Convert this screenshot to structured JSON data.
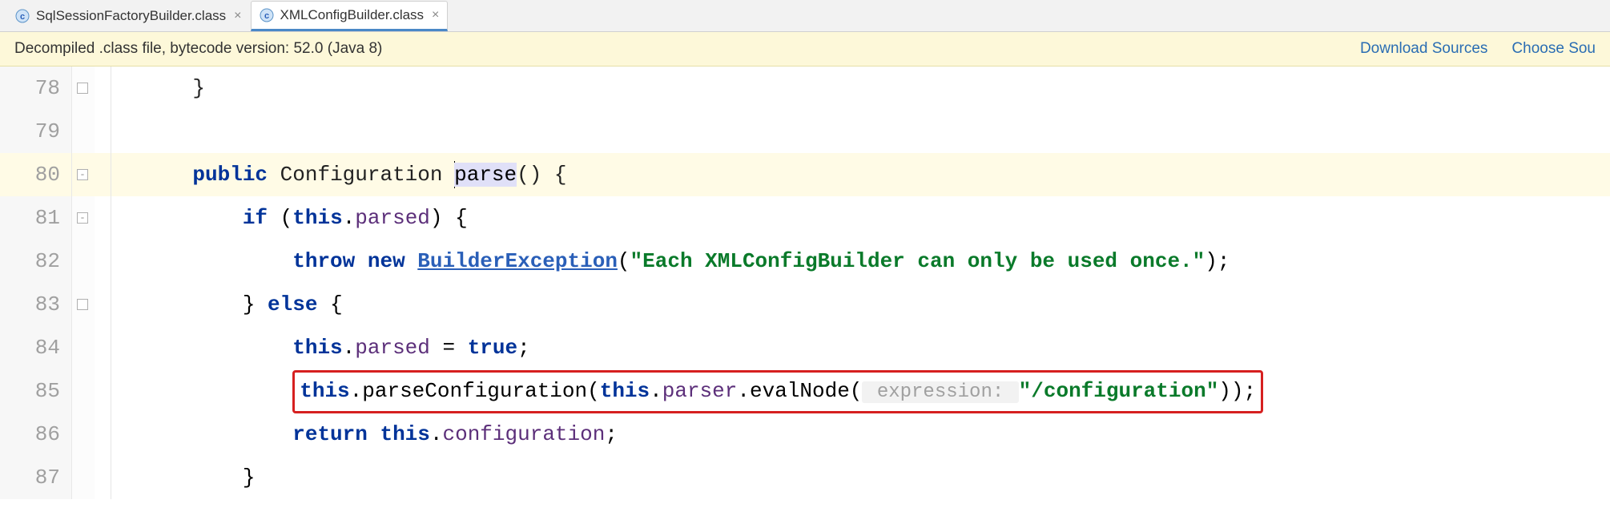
{
  "tabs": [
    {
      "label": "SqlSessionFactoryBuilder.class",
      "active": false
    },
    {
      "label": "XMLConfigBuilder.class",
      "active": true
    }
  ],
  "notice": {
    "message": "Decompiled .class file, bytecode version: 52.0 (Java 8)",
    "links": {
      "download": "Download Sources",
      "choose": "Choose Sou"
    }
  },
  "line_numbers": [
    "78",
    "79",
    "80",
    "81",
    "82",
    "83",
    "84",
    "85",
    "86",
    "87"
  ],
  "code": {
    "l78": "}",
    "l80": {
      "kw_public": "public",
      "type": "Configuration",
      "method": "parse",
      "tail": "() {"
    },
    "l81": {
      "kw_if": "if",
      "open": " (",
      "kw_this": "this",
      "dot": ".",
      "field": "parsed",
      "close": ") {"
    },
    "l82": {
      "kw_throw": "throw",
      "kw_new": "new",
      "cls": "BuilderException",
      "open": "(",
      "str": "\"Each XMLConfigBuilder can only be used once.\"",
      "close": ");"
    },
    "l83": {
      "close_brace": "}",
      "kw_else": "else",
      "open_brace": "{"
    },
    "l84": {
      "kw_this": "this",
      "dot1": ".",
      "field": "parsed",
      "eq": " = ",
      "kw_true": "true",
      "semi": ";"
    },
    "l85": {
      "kw_this1": "this",
      "dot1": ".",
      "m1": "parseConfiguration(",
      "kw_this2": "this",
      "dot2": ".",
      "f2": "parser",
      "dot3": ".",
      "m2": "evalNode(",
      "hint": " expression: ",
      "str": "\"/configuration\"",
      "close": "));"
    },
    "l86": {
      "kw_return": "return",
      "sp": " ",
      "kw_this": "this",
      "dot": ".",
      "field": "configuration",
      "semi": ";"
    },
    "l87": "}"
  }
}
